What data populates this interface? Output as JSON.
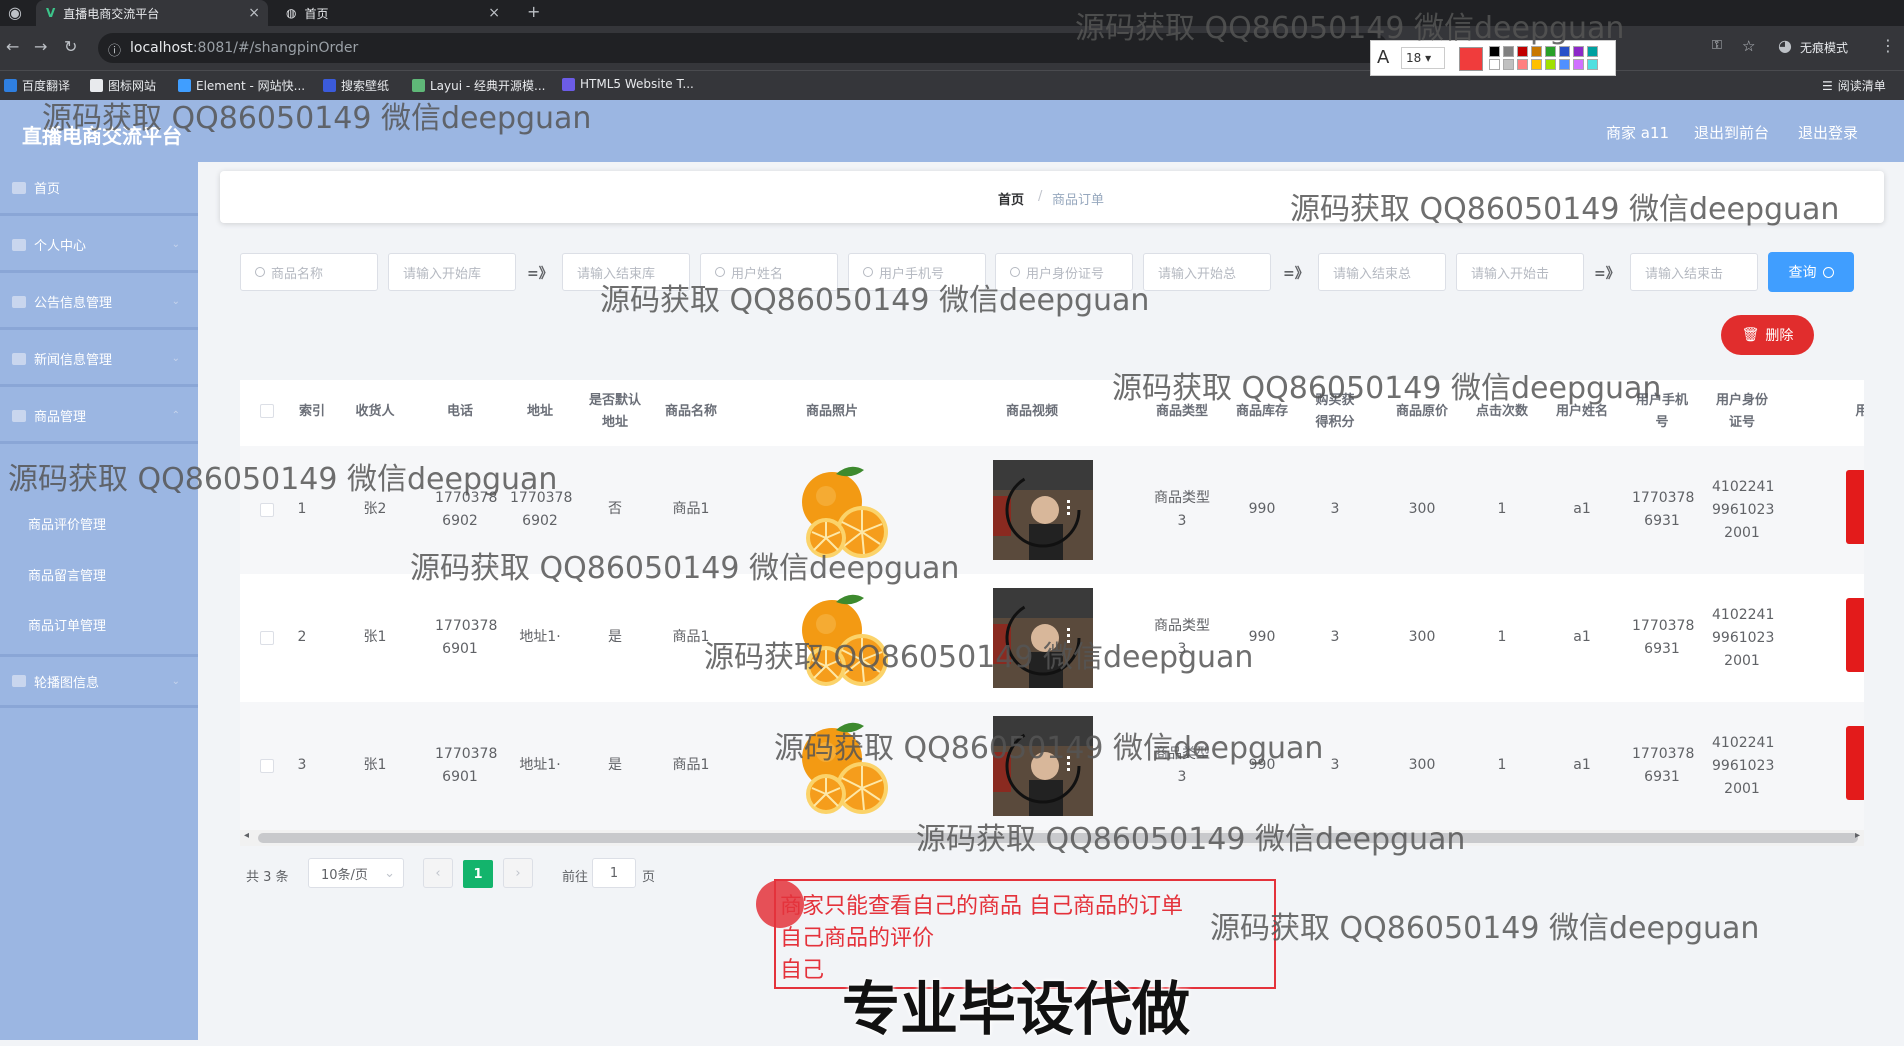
{
  "browser": {
    "tabs": [
      {
        "label": "直播电商交流平台",
        "close": "×"
      },
      {
        "label": "首页",
        "close": "×"
      }
    ],
    "new_tab": "+",
    "url_host": "localhost",
    "url_path": ":8081/#/shangpinOrder",
    "bookmarks": [
      "百度翻译",
      "图标网站",
      "Element - 网站快...",
      "搜索壁纸",
      "Layui - 经典开源模...",
      "HTML5 Website T..."
    ],
    "reading_list": "阅读清单",
    "incognito": "无痕模式",
    "picker_font_size": "18",
    "picker_letter": "A",
    "picker_colors": [
      "#f03c3c",
      "#000000",
      "#808080",
      "#c00000",
      "#c87800",
      "#28a028",
      "#2850c8",
      "#8c28c8",
      "#00a0a0",
      "#ffffff",
      "#c0c0c0",
      "#ff8080",
      "#ffc000",
      "#a0e000",
      "#5090ff",
      "#d070ff",
      "#50e0e0"
    ]
  },
  "header": {
    "title": "直播电商交流平台",
    "user": "商家 a11",
    "back_to_front": "退出到前台",
    "logout": "退出登录"
  },
  "sidebar": {
    "items": [
      {
        "label": "首页"
      },
      {
        "label": "个人中心"
      },
      {
        "label": "公告信息管理"
      },
      {
        "label": "新闻信息管理"
      },
      {
        "label": "商品管理"
      },
      {
        "label": "轮播图信息"
      }
    ],
    "sub_items": [
      "商品评价管理",
      "商品留言管理",
      "商品订单管理"
    ]
  },
  "breadcrumb": {
    "home": "首页",
    "sep": "/",
    "current": "商品订单"
  },
  "search": {
    "fields": [
      {
        "placeholder": "商品名称",
        "icon": true
      },
      {
        "placeholder": "请输入开始库",
        "icon": false
      },
      {
        "placeholder": "请输入结束库",
        "icon": false
      },
      {
        "placeholder": "用户姓名",
        "icon": true
      },
      {
        "placeholder": "用户手机号",
        "icon": true
      },
      {
        "placeholder": "用户身份证号",
        "icon": true
      },
      {
        "placeholder": "请输入开始总",
        "icon": false
      },
      {
        "placeholder": "请输入结束总",
        "icon": false
      },
      {
        "placeholder": "请输入开始击",
        "icon": false
      },
      {
        "placeholder": "请输入结束击",
        "icon": false
      }
    ],
    "range_arrow": "=》",
    "query_label": "查询",
    "delete_label": "删除"
  },
  "table": {
    "headers": [
      "索引",
      "收货人",
      "电话",
      "地址",
      "是否默认地址",
      "商品名称",
      "商品照片",
      "商品视频",
      "商品类型",
      "商品库存",
      "购买获得积分",
      "商品原价",
      "点击次数",
      "用户姓名",
      "用户手机号",
      "用户身份证号",
      "用"
    ],
    "rows": [
      {
        "index": "1",
        "receiver": "张2",
        "phone": "17703786902",
        "address": "17703786902",
        "is_default": "否",
        "product_name": "商品1",
        "product_type": "商品类型3",
        "stock": "990",
        "points": "3",
        "price": "300",
        "clicks": "1",
        "user_name": "a1",
        "user_phone": "17703786931",
        "user_id": "410224199610232001"
      },
      {
        "index": "2",
        "receiver": "张1",
        "phone": "17703786901",
        "address": "地址1·",
        "is_default": "是",
        "product_name": "商品1",
        "product_type": "商品类型3",
        "stock": "990",
        "points": "3",
        "price": "300",
        "clicks": "1",
        "user_name": "a1",
        "user_phone": "17703786931",
        "user_id": "410224199610232001"
      },
      {
        "index": "3",
        "receiver": "张1",
        "phone": "17703786901",
        "address": "地址1·",
        "is_default": "是",
        "product_name": "商品1",
        "product_type": "商品类型3",
        "stock": "990",
        "points": "3",
        "price": "300",
        "clicks": "1",
        "user_name": "a1",
        "user_phone": "17703786931",
        "user_id": "410224199610232001"
      }
    ]
  },
  "pagination": {
    "total": "共 3 条",
    "page_size": "10条/页",
    "prev": "‹",
    "current_page": "1",
    "next": "›",
    "goto_label": "前往",
    "goto_value": "1",
    "page_suffix": "页"
  },
  "annotation": {
    "lines": [
      "商家只能查看自己的商品 自己商品的订单",
      "自己商品的评价",
      "自己"
    ],
    "caption": "专业毕设代做"
  },
  "watermark": "源码获取 QQ86050149 微信deepguan"
}
